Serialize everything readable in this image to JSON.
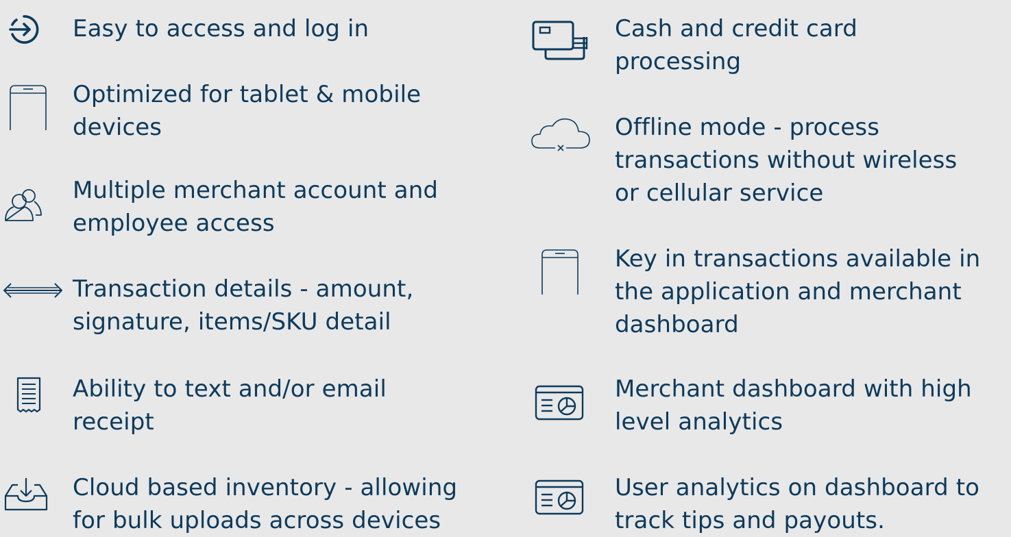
{
  "colors": {
    "background": "#e8e8e8",
    "text": "#0d3a5c",
    "icon": "#0d3a5c"
  },
  "left_column": [
    {
      "icon": "login-arrow-icon",
      "text": "Easy to access and log in"
    },
    {
      "icon": "tablet-icon",
      "text": "Optimized for tablet & mobile\ndevices"
    },
    {
      "icon": "users-icon",
      "text": "Multiple merchant account and\nemployee access"
    },
    {
      "icon": "double-arrow-icon",
      "text": "Transaction details - amount,\nsignature, items/SKU detail"
    },
    {
      "icon": "receipt-icon",
      "text": "Ability to text and/or email\nreceipt"
    },
    {
      "icon": "cloud-upload-tray-icon",
      "text": "Cloud based inventory - allowing\nfor bulk uploads across devices"
    }
  ],
  "right_column": [
    {
      "icon": "cards-icon",
      "text": "Cash and credit card\nprocessing"
    },
    {
      "icon": "cloud-offline-icon",
      "text": "Offline mode - process\ntransactions without wireless\nor cellular service"
    },
    {
      "icon": "tablet-icon",
      "text": "Key in transactions available in\nthe application and merchant\ndashboard"
    },
    {
      "icon": "dashboard-chart-icon",
      "text": "Merchant dashboard with high\nlevel analytics"
    },
    {
      "icon": "dashboard-chart-icon",
      "text": "User analytics on dashboard to\ntrack tips and payouts."
    }
  ]
}
